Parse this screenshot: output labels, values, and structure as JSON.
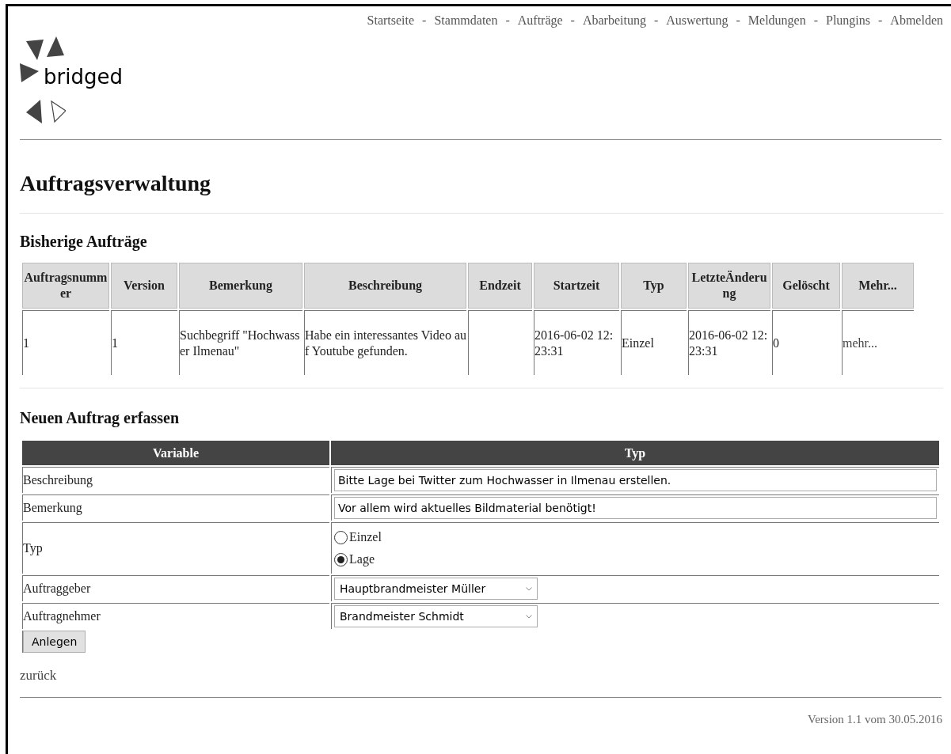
{
  "nav": {
    "links": [
      "Startseite",
      "Stammdaten",
      "Aufträge",
      "Abarbeitung",
      "Auswertung",
      "Meldungen",
      "Plungins",
      "Abmelden"
    ],
    "separators": [
      "-",
      "-",
      "-",
      "-",
      "-",
      "-",
      "-"
    ]
  },
  "logo": {
    "text": "bridged"
  },
  "title": "Auftragsverwaltung",
  "orders": {
    "heading": "Bisherige Aufträge",
    "columns": [
      "Auftragsnummer",
      "Version",
      "Bemerkung",
      "Beschreibung",
      "Endzeit",
      "Startzeit",
      "Typ",
      "LetzteÄnderung",
      "Gelöscht",
      "Mehr..."
    ],
    "rows": [
      {
        "cells": [
          "1",
          "1",
          "Suchbegriff \"Hochwasser Ilmenau\"",
          "Habe ein interessantes Video auf Youtube gefunden.",
          "",
          "2016-06-02 12:23:31",
          "Einzel",
          "2016-06-02 12:23:31",
          "0"
        ],
        "link": "mehr..."
      }
    ]
  },
  "form": {
    "heading": "Neuen Auftrag erfassen",
    "columns": [
      "Variable",
      "Typ"
    ],
    "rows": [
      {
        "kind": "text",
        "label": "Beschreibung",
        "value": "Bitte Lage bei Twitter zum Hochwasser in Ilmenau erstellen."
      },
      {
        "kind": "text",
        "label": "Bemerkung",
        "value": "Vor allem wird aktuelles Bildmaterial benötigt!"
      },
      {
        "kind": "radio",
        "label": "Typ",
        "options": [
          {
            "label": "Einzel",
            "selected": false
          },
          {
            "label": "Lage",
            "selected": true
          }
        ]
      },
      {
        "kind": "select",
        "label": "Auftraggeber",
        "value": "Hauptbrandmeister Müller"
      },
      {
        "kind": "select",
        "label": "Auftragnehmer",
        "value": "Brandmeister Schmidt"
      }
    ],
    "submit": "Anlegen"
  },
  "back_link": "zurück",
  "footer": "Version 1.1 vom 30.05.2016"
}
